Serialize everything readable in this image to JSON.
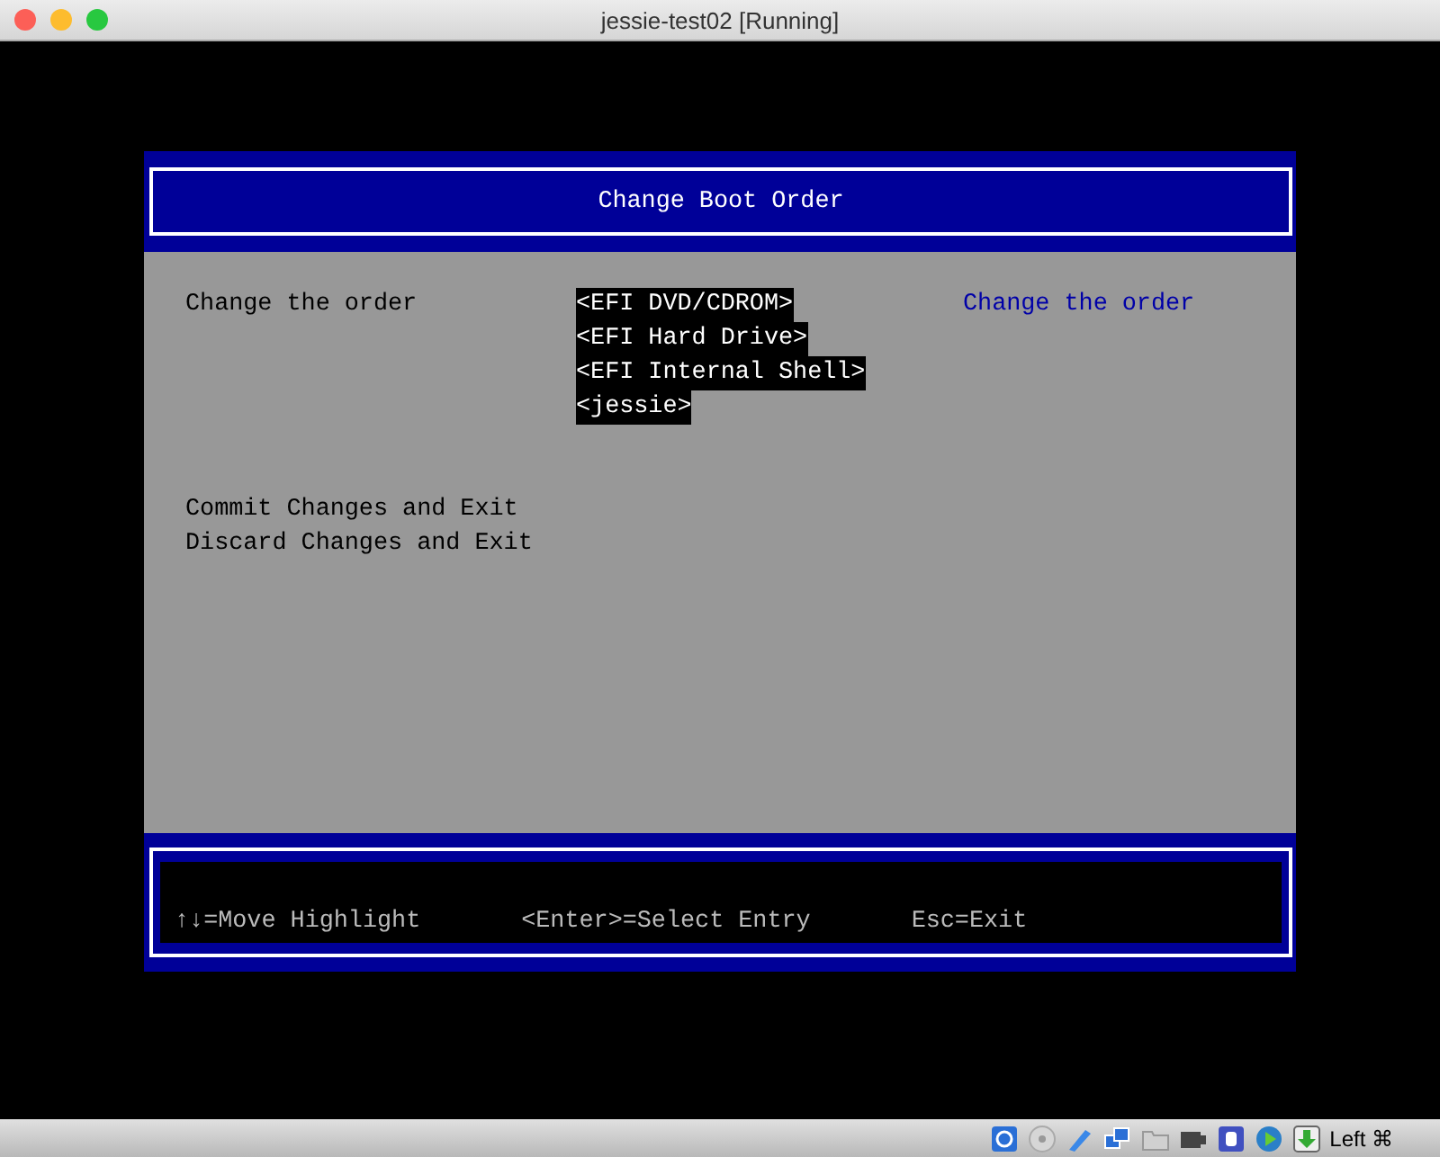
{
  "window": {
    "title": "jessie-test02 [Running]"
  },
  "header": {
    "title": "Change Boot Order"
  },
  "menu": {
    "label": "Change the order",
    "order_items": [
      "<EFI DVD/CDROM>",
      "<EFI Hard Drive>",
      "<EFI Internal Shell>",
      "<jessie>"
    ],
    "help": "Change the order"
  },
  "actions": [
    "Commit Changes and Exit",
    "Discard Changes and Exit"
  ],
  "footer": [
    "↑↓=Move Highlight",
    "<Enter>=Select Entry",
    "Esc=Exit"
  ],
  "status_bar": {
    "host_key": "Left ⌘"
  }
}
